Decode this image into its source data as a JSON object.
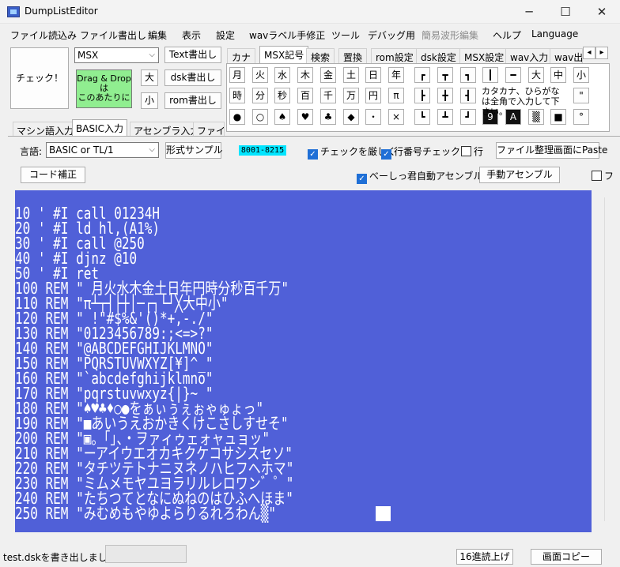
{
  "window": {
    "title": "DumpListEditor",
    "minimize_icon": "─",
    "maximize_icon": "☐",
    "close_icon": "✕"
  },
  "menu": [
    "ファイル読込み",
    "ファイル書出し",
    "編集",
    "表示",
    "設定",
    "wavラベル手修正",
    "ツール",
    "デバッグ用",
    "簡易波形編集",
    "ヘルプ",
    "Language"
  ],
  "left_panel": {
    "check_button": "チェック！",
    "machine_select": "MSX",
    "text_export": "Text書出し",
    "drop_area": "Drag & Drop\nは\nこのあたりに",
    "size_large": "大",
    "size_small": "小",
    "dsk_export": "dsk書出し",
    "rom_export": "rom書出し"
  },
  "top_tabs": [
    "カナ",
    "MSX記号",
    "検索",
    "置換",
    "rom設定",
    "dsk設定",
    "MSX設定",
    "wav入力",
    "wav出力"
  ],
  "tab_scroll": {
    "left": "◂",
    "right": "▸"
  },
  "keypad": {
    "row1": [
      "月",
      "火",
      "水",
      "木",
      "金",
      "土",
      "日",
      "年",
      "┏",
      "┳",
      "┓",
      "┃",
      "━",
      "大",
      "中",
      "小"
    ],
    "row2": [
      "時",
      "分",
      "秒",
      "百",
      "千",
      "万",
      "円",
      "π",
      "┣",
      "╋",
      "┫",
      "\""
    ],
    "row3": [
      "●",
      "○",
      "♠",
      "♥",
      "♣",
      "◆",
      "・",
      "×",
      "┗",
      "┻",
      "┛",
      "9",
      "A",
      "▒",
      "■",
      "°"
    ],
    "note": "カタカナ、ひらがなは全角で入力して下さい。"
  },
  "lower_tabs": [
    "マシン語入力",
    "BASIC入力",
    "アセンブラ入力",
    "ファイル"
  ],
  "options": {
    "lang_label": "言語:",
    "lang_value": "BASIC or TL/1",
    "format_sample": "形式サンプル",
    "address_badge": "8001-8215",
    "strict_check": "チェックを厳しく",
    "line_check": "行番号チェック",
    "row_label": "行",
    "paste_button": "ファイル整理画面にPaste",
    "code_fix": "コード補正",
    "auto_asm": "べーしっ君自動アセンブル",
    "manual_asm": "手動アセンブル",
    "extra_label": "フ"
  },
  "screen_lines": [
    "10 ' #I call 01234H",
    "20 ' #I ld hl,(A1%)",
    "30 ' #I call @250",
    "40 ' #I djnz @10",
    "50 ' #I ret",
    "100 REM \" 月火水木金土日年円時分秒百千万\"",
    "110 REM \"π┴┬┤├┼│─┌┐└┘╳大中小\"",
    "120 REM \" !\"#$%&'()*+,-./\"",
    "130 REM \"0123456789:;<=>?\"",
    "140 REM \"@ABCDEFGHIJKLMNO\"",
    "150 REM \"PQRSTUVWXYZ[¥]^_\"",
    "160 REM \"`abcdefghijklmno\"",
    "170 REM \"pqrstuvwxyz{|}~ \"",
    "180 REM \"♠♥♣♦○●をぁぃぅぇぉゃゅょっ\"",
    "190 REM \"■あいうえおかきくけこさしすせそ\"",
    "200 REM \"▣。「」、・ヲァィゥェォャュョッ\"",
    "210 REM \"ーアイウエオカキクケコサシスセソ\"",
    "220 REM \"タチツテトナニヌネノハヒフヘホマ\"",
    "230 REM \"ミムメモヤユヨラリルレロワン゛゜\"",
    "240 REM \"たちつてとなにぬねのはひふへほま\"",
    "250 REM \"みむめもやゆよらりるれろわん▒\""
  ],
  "status": {
    "message": "test.dskを書き出しました。",
    "hex_button": "16進読上げ",
    "copy_button": "画面コピー"
  },
  "colors": {
    "screen_bg": "#5060d8",
    "screen_fg": "#ffffff",
    "drop_bg": "#90ee90",
    "badge_bg": "#00e5ff"
  }
}
